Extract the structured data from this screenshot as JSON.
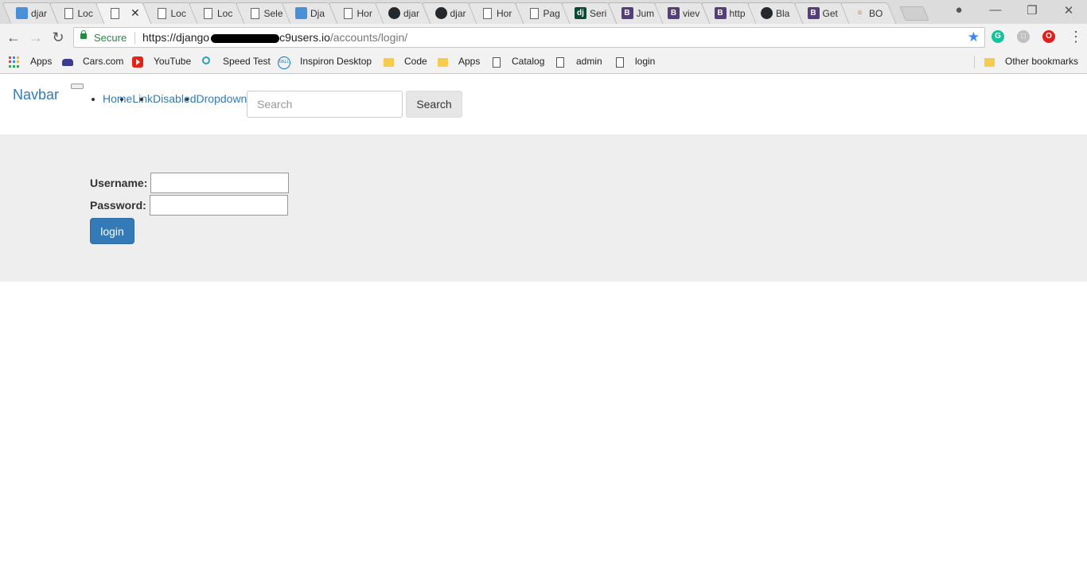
{
  "browser": {
    "tabs": [
      {
        "title": "djar",
        "icon": "fav-blue",
        "glyph": ""
      },
      {
        "title": "Loc",
        "icon": "fav-doc",
        "glyph": ""
      },
      {
        "title": "",
        "icon": "fav-doc",
        "glyph": "",
        "active": true
      },
      {
        "title": "Loc",
        "icon": "fav-doc",
        "glyph": ""
      },
      {
        "title": "Loc",
        "icon": "fav-doc",
        "glyph": ""
      },
      {
        "title": "Sele",
        "icon": "fav-doc",
        "glyph": ""
      },
      {
        "title": "Dja",
        "icon": "fav-blue",
        "glyph": ""
      },
      {
        "title": "Hor",
        "icon": "fav-doc",
        "glyph": ""
      },
      {
        "title": "djar",
        "icon": "fav-gh",
        "glyph": ""
      },
      {
        "title": "djar",
        "icon": "fav-gh",
        "glyph": ""
      },
      {
        "title": "Hor",
        "icon": "fav-doc",
        "glyph": ""
      },
      {
        "title": "Pag",
        "icon": "fav-doc",
        "glyph": ""
      },
      {
        "title": "Seri",
        "icon": "fav-dj",
        "glyph": "dj"
      },
      {
        "title": "Jum",
        "icon": "fav-b",
        "glyph": "B"
      },
      {
        "title": "viev",
        "icon": "fav-b",
        "glyph": "B"
      },
      {
        "title": "http",
        "icon": "fav-b",
        "glyph": "B"
      },
      {
        "title": "Bla",
        "icon": "fav-gh",
        "glyph": ""
      },
      {
        "title": "Get",
        "icon": "fav-b",
        "glyph": "B"
      },
      {
        "title": "BO",
        "icon": "fav-so",
        "glyph": "≡"
      }
    ],
    "close_glyph": "✕",
    "window_controls": {
      "profile": "●",
      "minimize": "—",
      "restore": "❐",
      "close": "✕"
    }
  },
  "toolbar": {
    "back": "←",
    "forward": "→",
    "reload": "↻",
    "secure_label": "Secure",
    "url_prefix": "https://django",
    "url_host_tail": "c9users.io",
    "url_path": "/accounts/login/",
    "star": "★",
    "menu": "⋮",
    "extensions": [
      {
        "name": "grammarly-icon",
        "glyph": "G",
        "color": "#15c39a"
      },
      {
        "name": "extension-icon",
        "glyph": "□",
        "color": "#c0c0c0"
      },
      {
        "name": "opera-icon",
        "glyph": "O",
        "color": "#e0201b"
      }
    ]
  },
  "bookmarks": {
    "items": [
      "Apps",
      "Cars.com",
      "YouTube",
      "Speed Test",
      "Inspiron Desktop",
      "Code",
      "Apps",
      "Catalog",
      "admin",
      "login"
    ],
    "other": "Other bookmarks"
  },
  "page": {
    "navbar": {
      "brand": "Navbar",
      "links": [
        "Home",
        "Link",
        "Disabled",
        "Dropdown"
      ],
      "search_placeholder": "Search",
      "search_button": "Search"
    },
    "login_form": {
      "username_label": "Username:",
      "password_label": "Password:",
      "submit_label": "login"
    }
  }
}
